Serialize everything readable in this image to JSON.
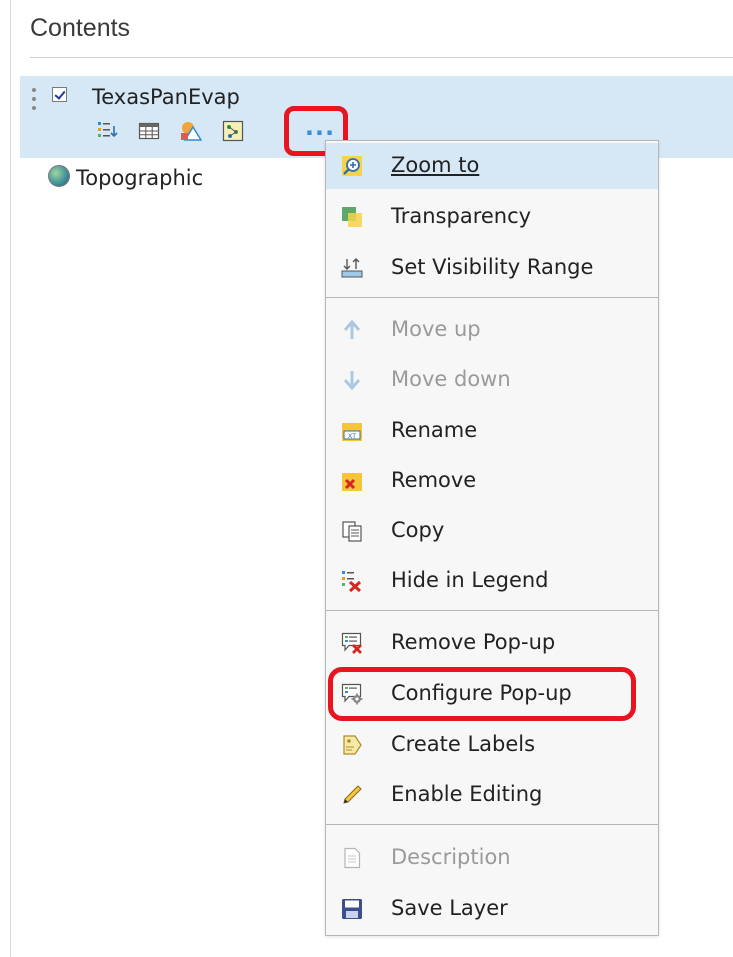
{
  "panel": {
    "title": "Contents"
  },
  "layers": [
    {
      "name": "TexasPanEvap",
      "visible": true
    },
    {
      "name": "Topographic"
    }
  ],
  "layer_tools": [
    "legend-icon",
    "attribute-table-icon",
    "change-style-icon",
    "perform-analysis-icon",
    "more-options-icon"
  ],
  "more_options": {
    "label": "..."
  },
  "context_menu": {
    "items": [
      {
        "label": "Zoom to",
        "icon": "zoom-to-icon",
        "state": "hover"
      },
      {
        "label": "Transparency",
        "icon": "transparency-icon"
      },
      {
        "label": "Set Visibility Range",
        "icon": "visibility-range-icon"
      },
      {
        "label": "Move up",
        "icon": "arrow-up-icon",
        "state": "disabled"
      },
      {
        "label": "Move down",
        "icon": "arrow-down-icon",
        "state": "disabled"
      },
      {
        "label": "Rename",
        "icon": "rename-icon"
      },
      {
        "label": "Remove",
        "icon": "remove-icon"
      },
      {
        "label": "Copy",
        "icon": "copy-icon"
      },
      {
        "label": "Hide in Legend",
        "icon": "hide-in-legend-icon"
      },
      {
        "label": "Remove Pop-up",
        "icon": "remove-popup-icon"
      },
      {
        "label": "Configure Pop-up",
        "icon": "configure-popup-icon"
      },
      {
        "label": "Create Labels",
        "icon": "create-labels-icon"
      },
      {
        "label": "Enable Editing",
        "icon": "pencil-icon"
      },
      {
        "label": "Description",
        "icon": "description-icon",
        "state": "disabled"
      },
      {
        "label": "Save Layer",
        "icon": "save-icon"
      }
    ]
  },
  "colors": {
    "selection": "#d6e8f5",
    "highlight_outline": "#e8141f",
    "accent": "#3a8fd8",
    "disabled_text": "#9a9a9a"
  }
}
